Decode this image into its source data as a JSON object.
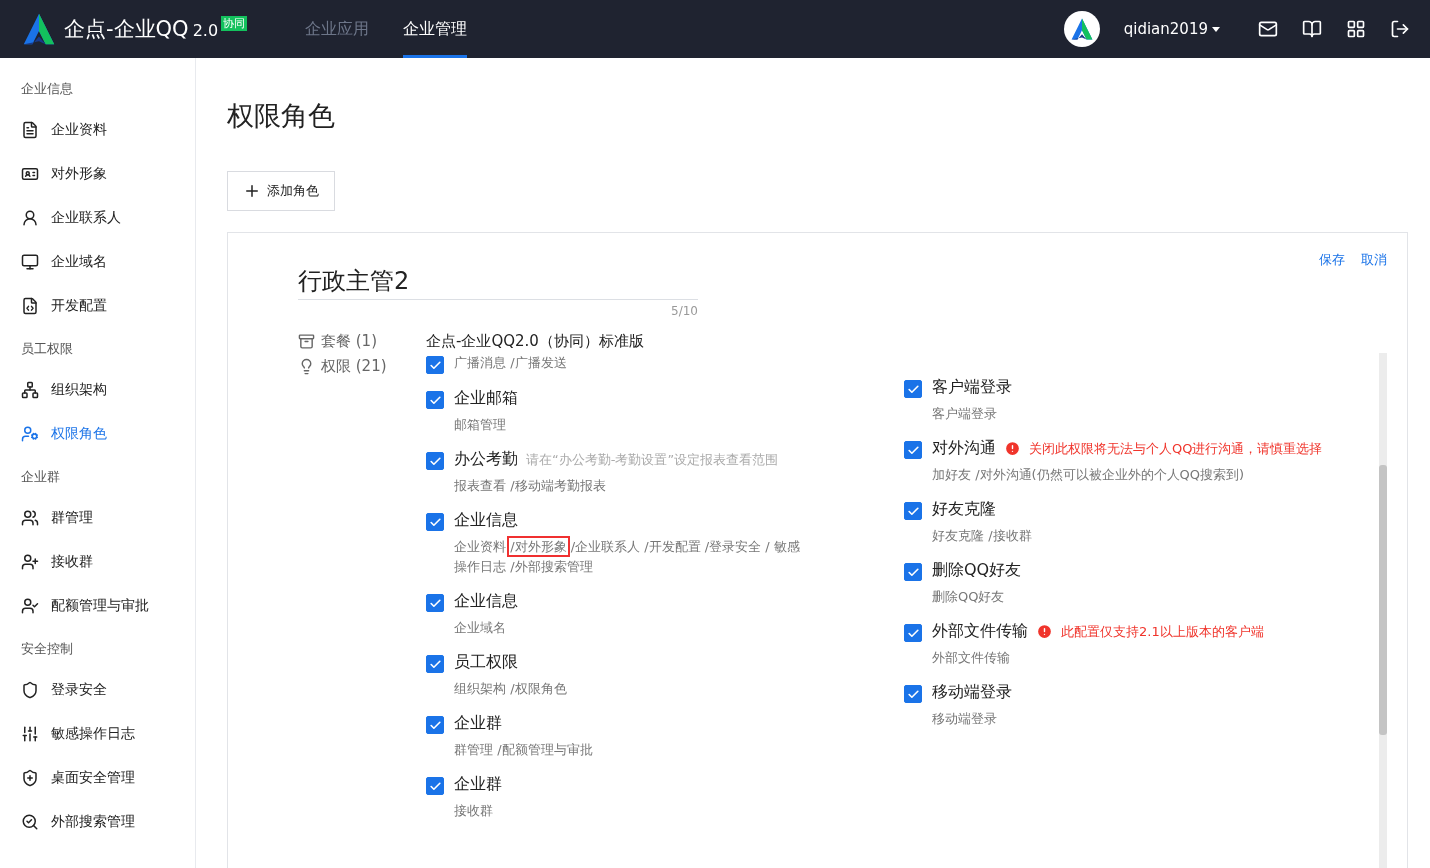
{
  "header": {
    "brand": "企点-企业QQ",
    "version": "2.0",
    "badge": "协同",
    "nav": [
      {
        "label": "企业应用",
        "selected": false
      },
      {
        "label": "企业管理",
        "selected": true
      }
    ],
    "user": "qidian2019"
  },
  "sidebar": [
    {
      "heading": "企业信息",
      "items": [
        {
          "label": "企业资料",
          "selected": false
        },
        {
          "label": "对外形象",
          "selected": false
        },
        {
          "label": "企业联系人",
          "selected": false
        },
        {
          "label": "企业域名",
          "selected": false
        },
        {
          "label": "开发配置",
          "selected": false
        }
      ]
    },
    {
      "heading": "员工权限",
      "items": [
        {
          "label": "组织架构",
          "selected": false
        },
        {
          "label": "权限角色",
          "selected": true
        }
      ]
    },
    {
      "heading": "企业群",
      "items": [
        {
          "label": "群管理",
          "selected": false
        },
        {
          "label": "接收群",
          "selected": false
        },
        {
          "label": "配额管理与审批",
          "selected": false
        }
      ]
    },
    {
      "heading": "安全控制",
      "items": [
        {
          "label": "登录安全",
          "selected": false
        },
        {
          "label": "敏感操作日志",
          "selected": false
        },
        {
          "label": "桌面安全管理",
          "selected": false
        },
        {
          "label": "外部搜索管理",
          "selected": false
        }
      ]
    }
  ],
  "page_title": "权限角色",
  "add_button": "添加角色",
  "editor": {
    "actions": [
      "保存",
      "取消"
    ],
    "role_name": "行政主管2",
    "counter": "5/10",
    "package_label": "套餐 (1)",
    "package_value": "企点-企业QQ2.0（协同）标准版",
    "permission_label": "权限 (21)",
    "left": [
      {
        "checked": true,
        "desc": [
          {
            "text": "广播消息 /广播发送",
            "highlighted": false
          }
        ]
      },
      {
        "title": "企业邮箱",
        "checked": true,
        "desc": [
          {
            "text": "邮箱管理",
            "highlighted": false
          }
        ]
      },
      {
        "title": "办公考勤",
        "checked": true,
        "hint": "请在“办公考勤-考勤设置”设定报表查看范围",
        "desc": [
          {
            "text": "报表查看 /移动端考勤报表",
            "highlighted": false
          }
        ]
      },
      {
        "title": "企业信息",
        "checked": true,
        "desc": [
          {
            "text": "企业资料 ",
            "highlighted": false
          },
          {
            "text": "/对外形象",
            "highlighted": true
          },
          {
            "text": " /企业联系人 /开发配置 /登录安全 / 敏感操作日志 /外部搜索管理",
            "highlighted": false
          }
        ]
      },
      {
        "title": "企业信息",
        "checked": true,
        "desc": [
          {
            "text": "企业域名",
            "highlighted": false
          }
        ]
      },
      {
        "title": "员工权限",
        "checked": true,
        "desc": [
          {
            "text": "组织架构 /权限角色",
            "highlighted": false
          }
        ]
      },
      {
        "title": "企业群",
        "checked": true,
        "desc": [
          {
            "text": "群管理 /配额管理与审批",
            "highlighted": false
          }
        ]
      },
      {
        "title": "企业群",
        "checked": true,
        "desc": [
          {
            "text": "接收群",
            "highlighted": false
          }
        ]
      }
    ],
    "right": [
      {
        "title": "客户端登录",
        "checked": true,
        "desc": [
          {
            "text": "客户端登录",
            "highlighted": false
          }
        ]
      },
      {
        "title": "对外沟通",
        "checked": true,
        "warning": "关闭此权限将无法与个人QQ进行沟通，请慎重选择",
        "desc": [
          {
            "text": "加好友 /对外沟通(仍然可以被企业外的个人QQ搜索到)",
            "highlighted": false
          }
        ]
      },
      {
        "title": "好友克隆",
        "checked": true,
        "desc": [
          {
            "text": "好友克隆 /接收群",
            "highlighted": false
          }
        ]
      },
      {
        "title": "删除QQ好友",
        "checked": true,
        "desc": [
          {
            "text": "删除QQ好友",
            "highlighted": false
          }
        ]
      },
      {
        "title": "外部文件传输",
        "checked": true,
        "warning": "此配置仅支持2.1以上版本的客户端",
        "desc": [
          {
            "text": "外部文件传输",
            "highlighted": false
          }
        ]
      },
      {
        "title": "移动端登录",
        "checked": true,
        "desc": [
          {
            "text": "移动端登录",
            "highlighted": false
          }
        ]
      }
    ]
  }
}
